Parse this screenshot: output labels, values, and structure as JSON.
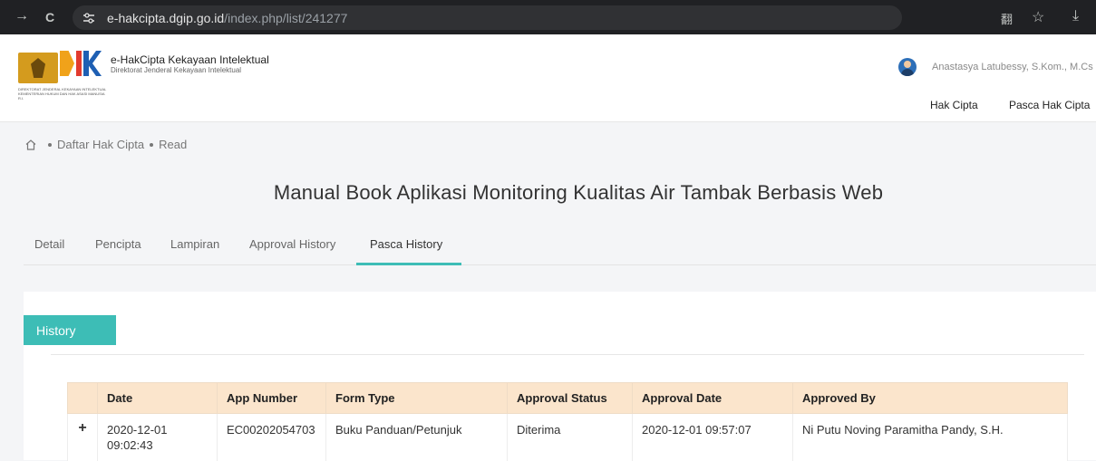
{
  "browser": {
    "url_host": "e-hakcipta.dgip.go.id",
    "url_path": "/index.php/list/241277",
    "forward_icon": "→",
    "reload_icon": "C",
    "translate_icon": "翻",
    "star_icon": "☆",
    "download_icon": "⤓"
  },
  "header": {
    "brand_title": "e-HakCipta Kekayaan Intelektual",
    "brand_subtitle": "Direktorat Jenderal Kekayaan Intelektual",
    "org_line": "DIREKTORAT JENDERAL KEKAYAAN INTELEKTUAL KEMENTERIAN HUKUM DAN HAK ASASI MANUSIA R.I.",
    "user_name": "Anastasya Latubessy, S.Kom., M.Cs",
    "menu": [
      "Hak Cipta",
      "Pasca Hak Cipta"
    ]
  },
  "breadcrumb": {
    "items": [
      "Daftar Hak Cipta",
      "Read"
    ]
  },
  "page_title": "Manual Book Aplikasi Monitoring Kualitas Air Tambak Berbasis Web",
  "tabs": [
    {
      "label": "Detail",
      "active": false
    },
    {
      "label": "Pencipta",
      "active": false
    },
    {
      "label": "Lampiran",
      "active": false
    },
    {
      "label": "Approval History",
      "active": false
    },
    {
      "label": "Pasca History",
      "active": true
    }
  ],
  "section": {
    "history_button": "History"
  },
  "table": {
    "columns": [
      "",
      "Date",
      "App Number",
      "Form Type",
      "Approval Status",
      "Approval Date",
      "Approved By"
    ],
    "rows": [
      {
        "expand": "+",
        "date_line1": "2020-12-01",
        "date_line2": "09:02:43",
        "app_number": "EC00202054703",
        "form_type": "Buku Panduan/Petunjuk",
        "approval_status": "Diterima",
        "approval_date": "2020-12-01 09:57:07",
        "approved_by": "Ni Putu Noving Paramitha Pandy, S.H."
      }
    ]
  },
  "colors": {
    "accent": "#3dbdb6",
    "table_header": "#fbe5cc",
    "browser_bg": "#202124"
  }
}
